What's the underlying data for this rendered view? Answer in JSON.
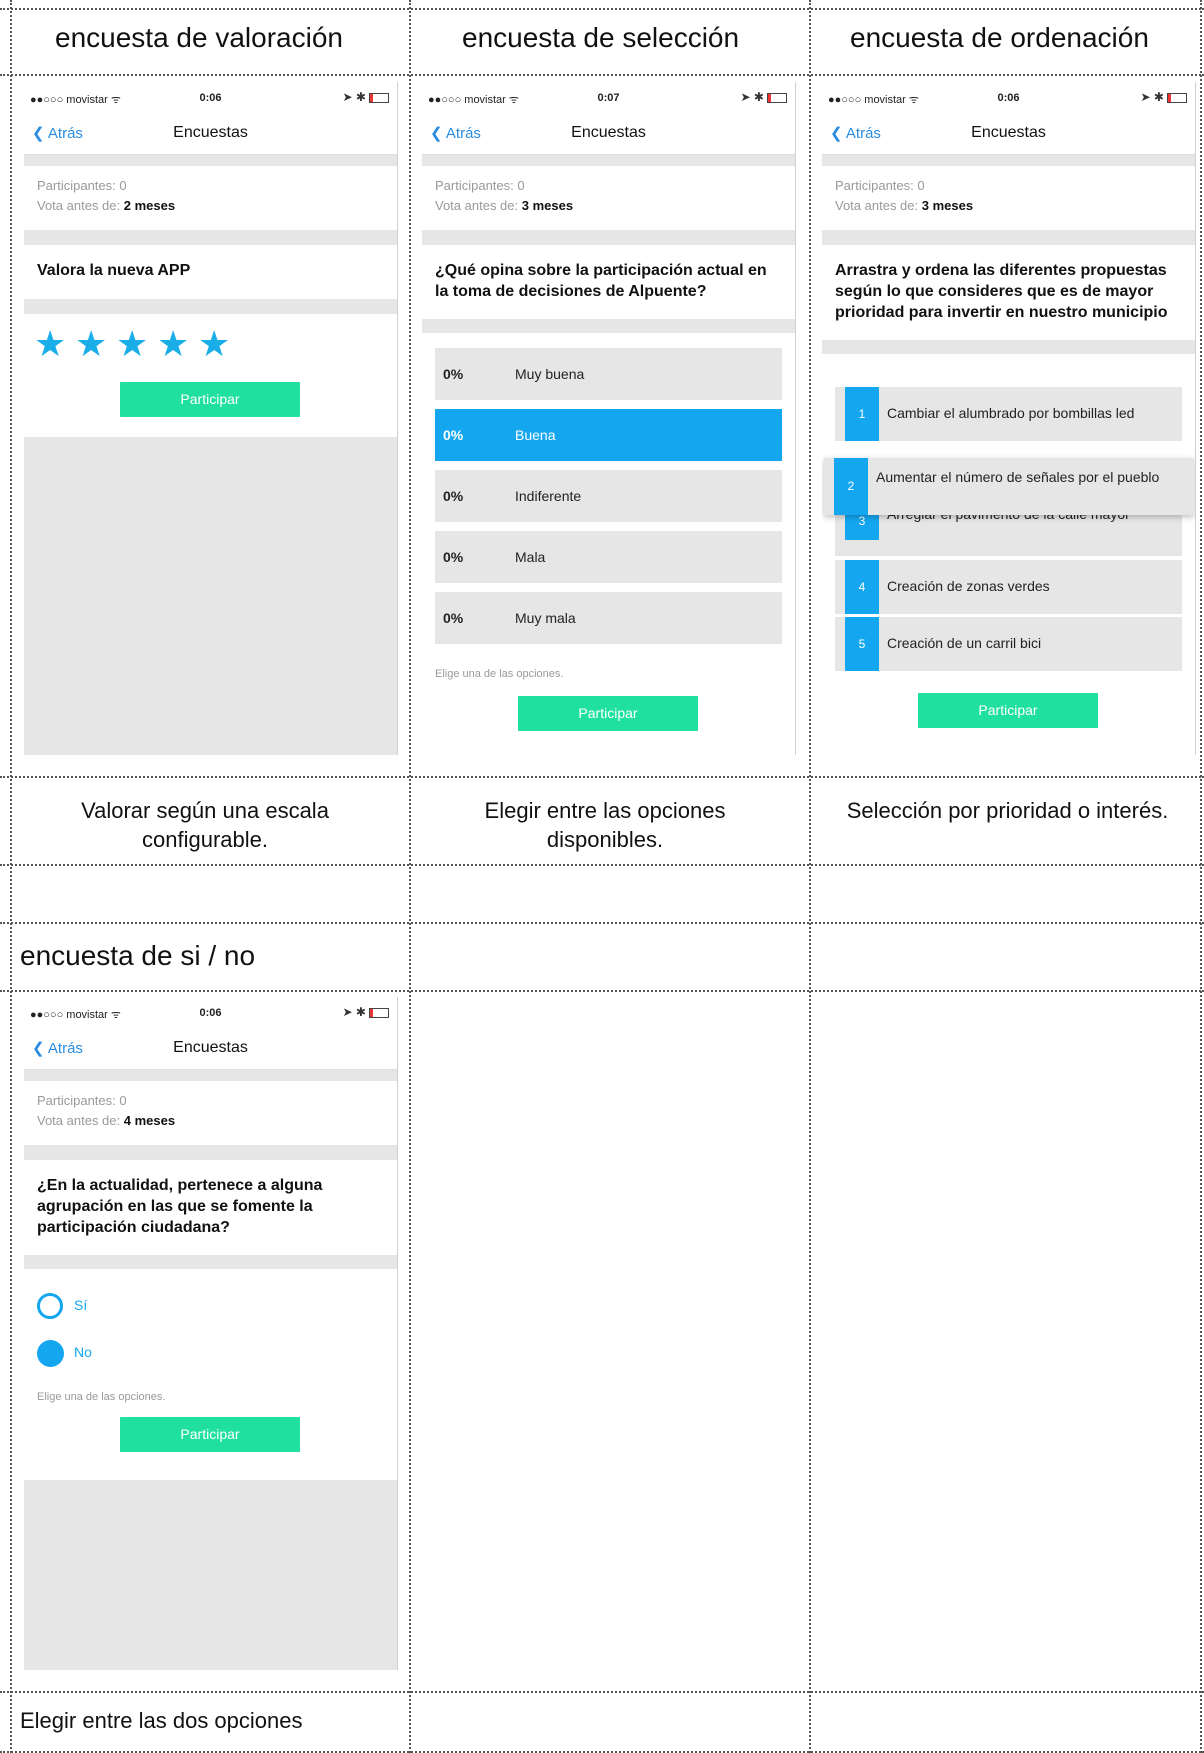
{
  "titles": {
    "rating": "encuesta de valoración",
    "selection": "encuesta de selección",
    "ordering": "encuesta de ordenación",
    "yesno": "encuesta de si / no"
  },
  "descriptions": {
    "rating": "Valorar según una escala configurable.",
    "selection": "Elegir entre las opciones disponibles.",
    "ordering": "Selección por prioridad o interés.",
    "yesno": "Elegir entre las dos opciones"
  },
  "common": {
    "carrier": "●●○○○ movistar ᯤ",
    "back_label": "Atrás",
    "nav_title": "Encuestas",
    "participants_label": "Participantes: 0",
    "vote_before_label": "Vota antes de:",
    "participate_label": "Participar",
    "hint": "Elige una de las opciones."
  },
  "phone_rating": {
    "time": "0:06",
    "deadline": "2 meses",
    "question": "Valora la nueva APP",
    "stars": 5
  },
  "phone_selection": {
    "time": "0:07",
    "deadline": "3 meses",
    "question": "¿Qué opina sobre la participación actual en la toma de decisiones de Alpuente?",
    "options": [
      {
        "pct": "0%",
        "label": "Muy buena",
        "selected": false
      },
      {
        "pct": "0%",
        "label": "Buena",
        "selected": true
      },
      {
        "pct": "0%",
        "label": "Indiferente",
        "selected": false
      },
      {
        "pct": "0%",
        "label": "Mala",
        "selected": false
      },
      {
        "pct": "0%",
        "label": "Muy mala",
        "selected": false
      }
    ]
  },
  "phone_ordering": {
    "time": "0:06",
    "deadline": "3 meses",
    "question": "Arrastra y ordena las diferentes propuestas según lo que consideres que es de mayor prioridad para invertir en nuestro municipio",
    "items": [
      {
        "num": "1",
        "label": "Cambiar el alumbrado por bombillas led"
      },
      {
        "num": "2",
        "label": "Aumentar el número de señales por el pueblo"
      },
      {
        "num": "3",
        "label": "Arreglar el pavimento de la calle mayor"
      },
      {
        "num": "4",
        "label": "Creación de zonas verdes"
      },
      {
        "num": "5",
        "label": "Creación de un carril bici"
      }
    ]
  },
  "phone_yesno": {
    "time": "0:06",
    "deadline": "4 meses",
    "question": "¿En la actualidad, pertenece a alguna agrupación en las que se fomente la participación ciudadana?",
    "yes_label": "Sí",
    "no_label": "No",
    "selected": "No"
  },
  "colors": {
    "accent_blue": "#14a7f0",
    "button_green": "#20e0a0",
    "link_blue": "#2a8de0"
  }
}
